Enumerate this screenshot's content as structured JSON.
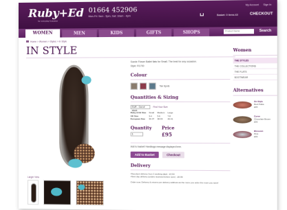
{
  "header": {
    "logo": "Ruby+Ed",
    "logo_sub": "for everyday footwear",
    "phone": "01664 452906",
    "hours": "Mon-Fri: 9am - 5pm, Sat: 10am - 4pm",
    "account_link": "My Account",
    "signin_link": "Sign In",
    "basket_summary": "Basket: 0 items £0",
    "checkout_label": "CHECKOUT"
  },
  "nav": {
    "tabs": [
      "WOMEN",
      "MEN",
      "KIDS",
      "GIFTS",
      "SHOPS"
    ],
    "search_placeholder": "Product Name",
    "search_button": "Search"
  },
  "breadcrumb": "Home > Women > Styles > In Style",
  "page_title": "IN STYLE",
  "product": {
    "description": "Suede Flower Ballet flats for Small. The best for any occasion.",
    "style_code": "Style: R1700",
    "colour_heading": "Colour",
    "colour_swatches": [
      "#8a7c6e",
      "#8c3b4a",
      "#5b7a8c"
    ],
    "colour_label": "Tan Spots",
    "qs_heading": "Quantities & Sizing",
    "size_select": "EUR - Out of stock",
    "size_guide": "Find Your Size",
    "size_table": [
      [
        "Ruby & Ed Size",
        "Small",
        "Medium",
        "Large"
      ],
      [
        "UK Size",
        "3-4",
        "5-6",
        "7-8"
      ],
      [
        "European Size",
        "36-37",
        "38-39",
        "40-41"
      ]
    ],
    "quantity_label": "Quantity",
    "quantity_value": "1",
    "price_label": "Price",
    "price": "£95",
    "notice": "Add to basket! Handbags message displayed here.",
    "add_button": "Add to Basket",
    "checkout_button": "Checkout",
    "delivery_heading": "Delivery",
    "delivery_items": [
      "Standard delivery from 2 working days - £4.50",
      "Next day delivery (orders received before 1pm) - £5.99"
    ],
    "delivery_note": "Order now. Delivery & returns per delivery address as the more you order the more you save!",
    "larger_view": "Larger View"
  },
  "sidebar": {
    "heading": "Women",
    "menu": [
      "THE STYLES",
      "THE COLLECTIONS",
      "THE FLATS",
      "BOOTWEAR"
    ],
    "alt_heading": "Alternatives",
    "alternatives": [
      {
        "name": "On Style",
        "line1": "Red Polka",
        "line2": "£95"
      },
      {
        "name": "Curve",
        "line1": "Chocolate Brown",
        "line2": "£95"
      },
      {
        "name": "Blossom",
        "line1": "Pink",
        "line2": "£95"
      }
    ]
  }
}
